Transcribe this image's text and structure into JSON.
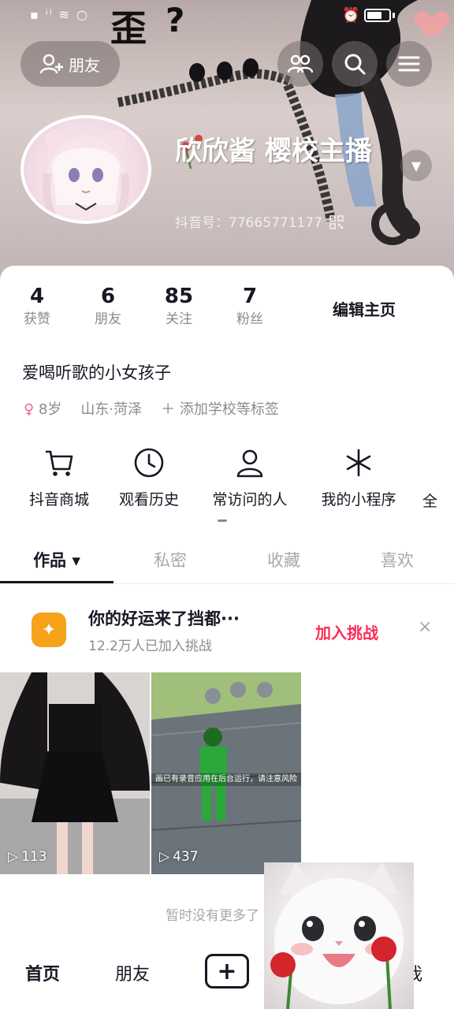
{
  "status_bar": {
    "left_indicators": "▪ ⁱˡ ≋ ○",
    "alarm_icon": "alarm-clock-icon",
    "battery_level": 0.7
  },
  "header": {
    "friend_button_label": "朋友",
    "nickname": "欣欣酱  樱校主播",
    "douyin_id": "抖音号：77665771177"
  },
  "stats": [
    {
      "value": "4",
      "label": "获赞"
    },
    {
      "value": "6",
      "label": "朋友"
    },
    {
      "value": "85",
      "label": "关注"
    },
    {
      "value": "7",
      "label": "粉丝"
    }
  ],
  "edit_profile_label": "编辑主页",
  "bio": "爱喝听歌的小女孩子",
  "tags": {
    "gender_symbol": "♀",
    "age": "8岁",
    "location": "山东·菏泽",
    "add_school": "添加学校等标签"
  },
  "services": [
    {
      "icon": "cart-icon",
      "label": "抖音商城"
    },
    {
      "icon": "clock-icon",
      "label": "观看历史"
    },
    {
      "icon": "person-icon",
      "label": "常访问的人"
    },
    {
      "icon": "sparkle-icon",
      "label": "我的小程序"
    }
  ],
  "services_more": "全",
  "tabs": [
    {
      "label": "作品",
      "active": true
    },
    {
      "label": "私密",
      "active": false
    },
    {
      "label": "收藏",
      "active": false
    },
    {
      "label": "喜欢",
      "active": false
    }
  ],
  "promo": {
    "title": "你的好运来了挡都···",
    "subtitle": "12.2万人已加入挑战",
    "join_label": "加入挑战",
    "close_symbol": "×"
  },
  "videos": [
    {
      "plays": "113"
    },
    {
      "plays": "437",
      "overlay_text": "画已有录音应用在后台运行，请注意风险"
    }
  ],
  "no_more_text": "暂时没有更多了",
  "bottom_nav": {
    "home": "首页",
    "friends": "朋友",
    "add": "+",
    "me": "我"
  },
  "colors": {
    "accent_red": "#fe2c55",
    "text_primary": "#161823",
    "text_secondary": "#8a8b91",
    "promo_orange": "#f7a21b"
  }
}
